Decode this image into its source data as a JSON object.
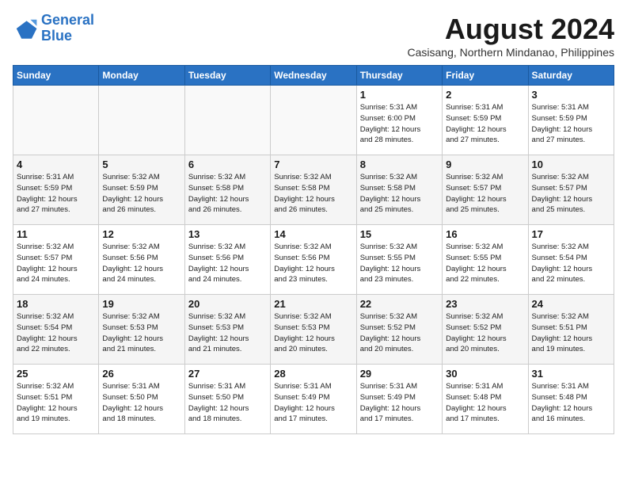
{
  "logo": {
    "line1": "General",
    "line2": "Blue"
  },
  "title": "August 2024",
  "location": "Casisang, Northern Mindanao, Philippines",
  "days_of_week": [
    "Sunday",
    "Monday",
    "Tuesday",
    "Wednesday",
    "Thursday",
    "Friday",
    "Saturday"
  ],
  "weeks": [
    [
      {
        "day": "",
        "info": ""
      },
      {
        "day": "",
        "info": ""
      },
      {
        "day": "",
        "info": ""
      },
      {
        "day": "",
        "info": ""
      },
      {
        "day": "1",
        "info": "Sunrise: 5:31 AM\nSunset: 6:00 PM\nDaylight: 12 hours\nand 28 minutes."
      },
      {
        "day": "2",
        "info": "Sunrise: 5:31 AM\nSunset: 5:59 PM\nDaylight: 12 hours\nand 27 minutes."
      },
      {
        "day": "3",
        "info": "Sunrise: 5:31 AM\nSunset: 5:59 PM\nDaylight: 12 hours\nand 27 minutes."
      }
    ],
    [
      {
        "day": "4",
        "info": "Sunrise: 5:31 AM\nSunset: 5:59 PM\nDaylight: 12 hours\nand 27 minutes."
      },
      {
        "day": "5",
        "info": "Sunrise: 5:32 AM\nSunset: 5:59 PM\nDaylight: 12 hours\nand 26 minutes."
      },
      {
        "day": "6",
        "info": "Sunrise: 5:32 AM\nSunset: 5:58 PM\nDaylight: 12 hours\nand 26 minutes."
      },
      {
        "day": "7",
        "info": "Sunrise: 5:32 AM\nSunset: 5:58 PM\nDaylight: 12 hours\nand 26 minutes."
      },
      {
        "day": "8",
        "info": "Sunrise: 5:32 AM\nSunset: 5:58 PM\nDaylight: 12 hours\nand 25 minutes."
      },
      {
        "day": "9",
        "info": "Sunrise: 5:32 AM\nSunset: 5:57 PM\nDaylight: 12 hours\nand 25 minutes."
      },
      {
        "day": "10",
        "info": "Sunrise: 5:32 AM\nSunset: 5:57 PM\nDaylight: 12 hours\nand 25 minutes."
      }
    ],
    [
      {
        "day": "11",
        "info": "Sunrise: 5:32 AM\nSunset: 5:57 PM\nDaylight: 12 hours\nand 24 minutes."
      },
      {
        "day": "12",
        "info": "Sunrise: 5:32 AM\nSunset: 5:56 PM\nDaylight: 12 hours\nand 24 minutes."
      },
      {
        "day": "13",
        "info": "Sunrise: 5:32 AM\nSunset: 5:56 PM\nDaylight: 12 hours\nand 24 minutes."
      },
      {
        "day": "14",
        "info": "Sunrise: 5:32 AM\nSunset: 5:56 PM\nDaylight: 12 hours\nand 23 minutes."
      },
      {
        "day": "15",
        "info": "Sunrise: 5:32 AM\nSunset: 5:55 PM\nDaylight: 12 hours\nand 23 minutes."
      },
      {
        "day": "16",
        "info": "Sunrise: 5:32 AM\nSunset: 5:55 PM\nDaylight: 12 hours\nand 22 minutes."
      },
      {
        "day": "17",
        "info": "Sunrise: 5:32 AM\nSunset: 5:54 PM\nDaylight: 12 hours\nand 22 minutes."
      }
    ],
    [
      {
        "day": "18",
        "info": "Sunrise: 5:32 AM\nSunset: 5:54 PM\nDaylight: 12 hours\nand 22 minutes."
      },
      {
        "day": "19",
        "info": "Sunrise: 5:32 AM\nSunset: 5:53 PM\nDaylight: 12 hours\nand 21 minutes."
      },
      {
        "day": "20",
        "info": "Sunrise: 5:32 AM\nSunset: 5:53 PM\nDaylight: 12 hours\nand 21 minutes."
      },
      {
        "day": "21",
        "info": "Sunrise: 5:32 AM\nSunset: 5:53 PM\nDaylight: 12 hours\nand 20 minutes."
      },
      {
        "day": "22",
        "info": "Sunrise: 5:32 AM\nSunset: 5:52 PM\nDaylight: 12 hours\nand 20 minutes."
      },
      {
        "day": "23",
        "info": "Sunrise: 5:32 AM\nSunset: 5:52 PM\nDaylight: 12 hours\nand 20 minutes."
      },
      {
        "day": "24",
        "info": "Sunrise: 5:32 AM\nSunset: 5:51 PM\nDaylight: 12 hours\nand 19 minutes."
      }
    ],
    [
      {
        "day": "25",
        "info": "Sunrise: 5:32 AM\nSunset: 5:51 PM\nDaylight: 12 hours\nand 19 minutes."
      },
      {
        "day": "26",
        "info": "Sunrise: 5:31 AM\nSunset: 5:50 PM\nDaylight: 12 hours\nand 18 minutes."
      },
      {
        "day": "27",
        "info": "Sunrise: 5:31 AM\nSunset: 5:50 PM\nDaylight: 12 hours\nand 18 minutes."
      },
      {
        "day": "28",
        "info": "Sunrise: 5:31 AM\nSunset: 5:49 PM\nDaylight: 12 hours\nand 17 minutes."
      },
      {
        "day": "29",
        "info": "Sunrise: 5:31 AM\nSunset: 5:49 PM\nDaylight: 12 hours\nand 17 minutes."
      },
      {
        "day": "30",
        "info": "Sunrise: 5:31 AM\nSunset: 5:48 PM\nDaylight: 12 hours\nand 17 minutes."
      },
      {
        "day": "31",
        "info": "Sunrise: 5:31 AM\nSunset: 5:48 PM\nDaylight: 12 hours\nand 16 minutes."
      }
    ]
  ]
}
